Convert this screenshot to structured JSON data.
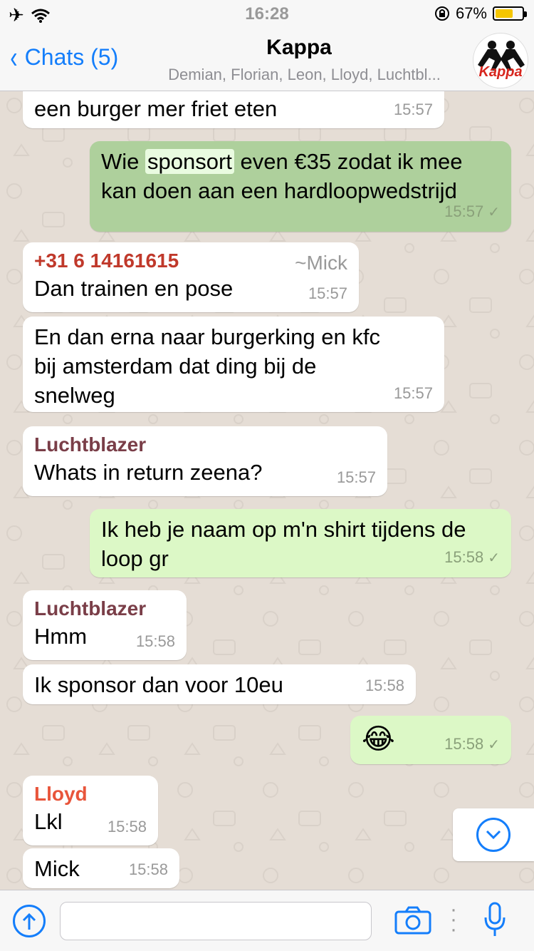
{
  "status": {
    "time": "16:28",
    "battery_percent": "67%",
    "battery_level": 0.67
  },
  "header": {
    "back_label": "Chats (5)",
    "title": "Kappa",
    "subtitle": "Demian, Florian, Leon, Lloyd, Luchtbl...",
    "avatar_text": "Kappa"
  },
  "messages": [
    {
      "text": "een burger mer friet eten",
      "time": "15:57"
    },
    {
      "text_before": "Wie ",
      "text_highlight": "sponsort",
      "text_after": " even €35 zodat ik mee kan doen aan een hardloopwedstrijd",
      "time": "15:57",
      "tick": "✓"
    },
    {
      "sender": "+31 6 14161615",
      "sender_alias": "~Mick",
      "text": "Dan trainen en pose",
      "time": "15:57"
    },
    {
      "text": "En dan erna naar burgerking en kfc bij amsterdam dat ding bij de snelweg",
      "time": "15:57"
    },
    {
      "sender": "Luchtblazer",
      "text": "Whats in return zeena?",
      "time": "15:57"
    },
    {
      "text": "Ik heb je naam op m'n shirt tijdens de loop gr",
      "time": "15:58",
      "tick": "✓"
    },
    {
      "sender": "Luchtblazer",
      "text": "Hmm",
      "time": "15:58"
    },
    {
      "text": "Ik sponsor dan voor 10eu",
      "time": "15:58"
    },
    {
      "text": "😂",
      "time": "15:58",
      "tick": "✓"
    },
    {
      "sender": "Lloyd",
      "text": "Lkl",
      "time": "15:58"
    },
    {
      "text": "Mick",
      "time": "15:58"
    }
  ],
  "colors": {
    "accent": "#147efb",
    "sender_mick": "#c0392b",
    "sender_luchtblazer": "#7a3e48",
    "sender_lloyd": "#e8553b"
  },
  "input": {
    "placeholder": ""
  }
}
